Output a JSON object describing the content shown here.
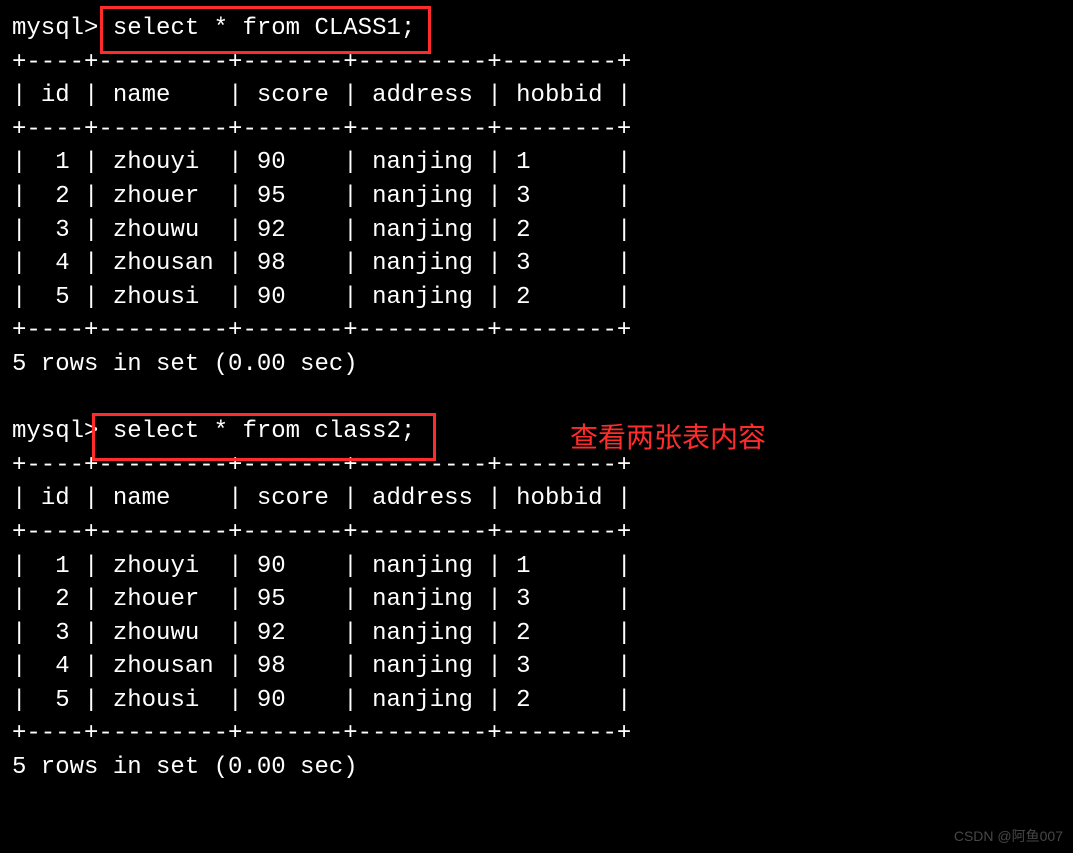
{
  "prompt": "mysql>",
  "query1": "select * from CLASS1;",
  "query2": "select * from class2;",
  "divider1": "+----+---------+-------+---------+--------+",
  "header": {
    "id": "id",
    "name": "name",
    "score": "score",
    "address": "address",
    "hobbid": "hobbid"
  },
  "rows1": [
    {
      "id": "1",
      "name": "zhouyi",
      "score": "90",
      "address": "nanjing",
      "hobbid": "1"
    },
    {
      "id": "2",
      "name": "zhouer",
      "score": "95",
      "address": "nanjing",
      "hobbid": "3"
    },
    {
      "id": "3",
      "name": "zhouwu",
      "score": "92",
      "address": "nanjing",
      "hobbid": "2"
    },
    {
      "id": "4",
      "name": "zhousan",
      "score": "98",
      "address": "nanjing",
      "hobbid": "3"
    },
    {
      "id": "5",
      "name": "zhousi",
      "score": "90",
      "address": "nanjing",
      "hobbid": "2"
    }
  ],
  "rows2": [
    {
      "id": "1",
      "name": "zhouyi",
      "score": "90",
      "address": "nanjing",
      "hobbid": "1"
    },
    {
      "id": "2",
      "name": "zhouer",
      "score": "95",
      "address": "nanjing",
      "hobbid": "3"
    },
    {
      "id": "3",
      "name": "zhouwu",
      "score": "92",
      "address": "nanjing",
      "hobbid": "2"
    },
    {
      "id": "4",
      "name": "zhousan",
      "score": "98",
      "address": "nanjing",
      "hobbid": "3"
    },
    {
      "id": "5",
      "name": "zhousi",
      "score": "90",
      "address": "nanjing",
      "hobbid": "2"
    }
  ],
  "result_summary": "5 rows in set (0.00 sec)",
  "annotation_text": "查看两张表内容",
  "watermark": "CSDN @阿鱼007"
}
